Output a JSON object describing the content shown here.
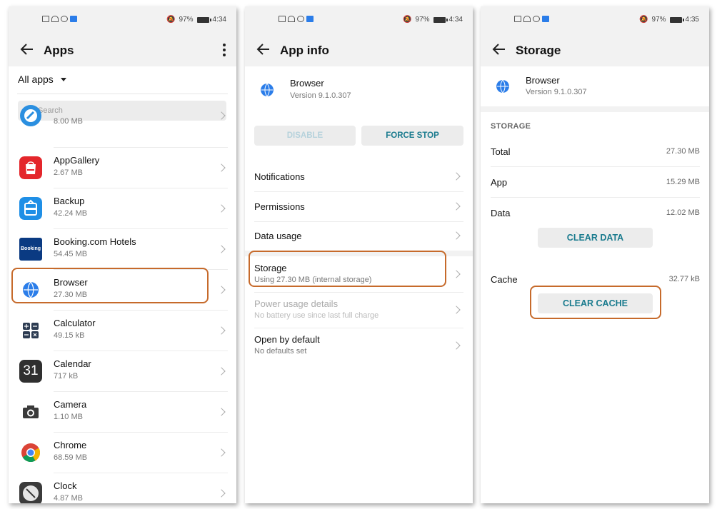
{
  "status": {
    "left_icons": [
      "sim-icon",
      "wifi-icon",
      "sync-icon",
      "app-notification-icon"
    ],
    "battery": "97%",
    "time_1": "4:34",
    "time_2": "4:34",
    "time_3": "4:35"
  },
  "screen1": {
    "title": "Apps",
    "filter_label": "All apps",
    "search_placeholder": "Search",
    "apps": [
      {
        "name": "",
        "size": "8.00 MB",
        "icon": "partial-app-icon",
        "color": "#2b8fe0"
      },
      {
        "name": "AppGallery",
        "size": "2.67 MB",
        "icon": "appgallery-icon",
        "color": "#e4262b"
      },
      {
        "name": "Backup",
        "size": "42.24 MB",
        "icon": "backup-icon",
        "color": "#1f8fe6"
      },
      {
        "name": "Booking.com Hotels",
        "size": "54.45 MB",
        "icon": "booking-icon",
        "color": "#0a3a82"
      },
      {
        "name": "Browser",
        "size": "27.30 MB",
        "icon": "browser-icon",
        "color": "#2b7de9"
      },
      {
        "name": "Calculator",
        "size": "49.15 kB",
        "icon": "calculator-icon",
        "color": "#2d3c52"
      },
      {
        "name": "Calendar",
        "size": "717 kB",
        "icon": "calendar-icon",
        "color": "#2f2f2f"
      },
      {
        "name": "Camera",
        "size": "1.10 MB",
        "icon": "camera-icon",
        "color": "#3a3a3a"
      },
      {
        "name": "Chrome",
        "size": "68.59 MB",
        "icon": "chrome-icon",
        "color": "#db4437"
      },
      {
        "name": "Clock",
        "size": "4.87 MB",
        "icon": "clock-icon",
        "color": "#3b3b3b"
      }
    ],
    "calendar_day": "31",
    "booking_logo": "Booking"
  },
  "screen2": {
    "title": "App info",
    "app_name": "Browser",
    "app_version": "Version 9.1.0.307",
    "disable_label": "DISABLE",
    "force_stop_label": "FORCE STOP",
    "items": [
      {
        "label": "Notifications"
      },
      {
        "label": "Permissions"
      },
      {
        "label": "Data usage"
      }
    ],
    "storage_label": "Storage",
    "storage_sub": "Using 27.30 MB (internal storage)",
    "power_label": "Power usage details",
    "power_sub": "No battery use since last full charge",
    "open_label": "Open by default",
    "open_sub": "No defaults set"
  },
  "screen3": {
    "title": "Storage",
    "app_name": "Browser",
    "app_version": "Version 9.1.0.307",
    "section_label": "STORAGE",
    "total_label": "Total",
    "total_value": "27.30 MB",
    "app_label": "App",
    "app_value": "15.29 MB",
    "data_label": "Data",
    "data_value": "12.02 MB",
    "clear_data_label": "CLEAR DATA",
    "cache_label": "Cache",
    "cache_value": "32.77 kB",
    "clear_cache_label": "CLEAR CACHE"
  },
  "colors": {
    "highlight": "#c66a2b",
    "accent_button_text": "#1a7b8e",
    "disabled_button_text": "#b6d2dc"
  }
}
